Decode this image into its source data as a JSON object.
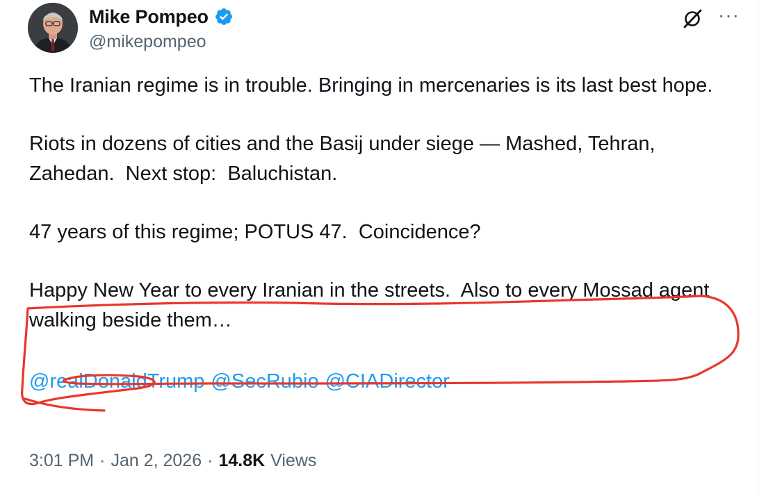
{
  "author": {
    "display_name": "Mike Pompeo",
    "handle": "@mikepompeo",
    "verified": true,
    "verified_color": "#1d9bf0"
  },
  "actions": {
    "grok_icon": "grok-icon",
    "more_label": "···"
  },
  "tweet": {
    "paragraphs": [
      "The Iranian regime is in trouble. Bringing in mercenaries is its last best hope.",
      "Riots in dozens of cities and the Basij under siege — Mashed, Tehran, Zahedan.  Next stop:  Baluchistan.",
      "47 years of this regime; POTUS 47.  Coincidence?",
      "Happy New Year to every Iranian in the streets.  Also to every Mossad agent walking beside them…"
    ],
    "mentions": [
      "@realDonaldTrump",
      "@SecRubio",
      "@CIADirector"
    ],
    "mention_color": "#1d9bf0"
  },
  "meta": {
    "time": "3:01 PM",
    "sep1": "·",
    "date": "Jan 2, 2026",
    "sep2": "·",
    "views_count": "14.8K",
    "views_label": "Views"
  },
  "annotation": {
    "type": "hand-drawn-red-circle",
    "color": "#e8372c"
  }
}
